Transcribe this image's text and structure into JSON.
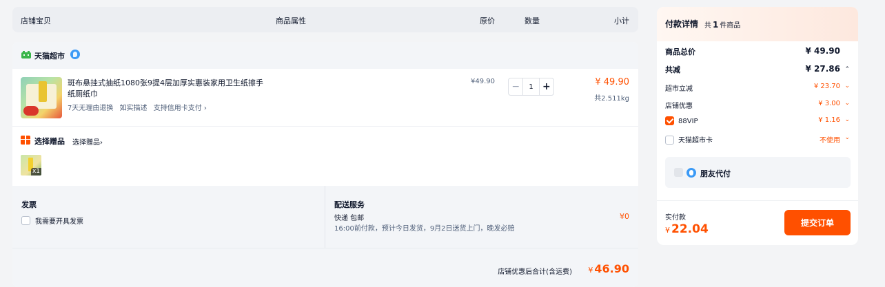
{
  "columns": {
    "item": "店铺宝贝",
    "attr": "商品属性",
    "price": "原价",
    "qty": "数量",
    "subtotal": "小计"
  },
  "shop": {
    "name": "天猫超市"
  },
  "product": {
    "title": "斑布悬挂式抽纸1080张9提4层加厚实惠装家用卫生纸擦手纸厕纸巾",
    "tags": [
      "7天无理由退换",
      "如实描述",
      "支持信用卡支付 ›"
    ],
    "price": "¥49.90",
    "quantity": "1",
    "subtotal": "¥ 49.90",
    "weight": "共2.511kg",
    "minus_symbol": "−",
    "plus_symbol": "+"
  },
  "gift": {
    "label": "选择赠品",
    "choose_link": "选择赠品›",
    "count": "x1"
  },
  "invoice": {
    "title": "发票",
    "option": "我需要开具发票"
  },
  "delivery": {
    "title": "配送服务",
    "method": "快递 包邮",
    "detail": "16:00前付款，预计今日发货，9月2日送货上门，晚发必赔",
    "fee": "¥0"
  },
  "shop_total": {
    "label": "店铺优惠后合计(含运费)",
    "currency": "¥",
    "value": "46.90"
  },
  "payment": {
    "title": "付款详情",
    "count_prefix": "共",
    "count": "1",
    "count_suffix": "件商品",
    "goods_total_label": "商品总价",
    "goods_total": "¥ 49.90",
    "discount_label": "共减",
    "discount_total": "¥ 27.86",
    "items": [
      {
        "label": "超市立减",
        "value": "¥ 23.70"
      },
      {
        "label": "店铺优惠",
        "value": "¥ 3.00"
      },
      {
        "label": "88VIP",
        "value": "¥ 1.16",
        "checked": true
      },
      {
        "label": "天猫超市卡",
        "value": "不使用",
        "checked": false
      }
    ],
    "friend_pay": "朋友代付",
    "actual_label": "实付款",
    "actual_currency": "¥",
    "actual_value": "22.04",
    "submit": "提交订单"
  },
  "colors": {
    "accent": "#ff5000",
    "text": "#11192d",
    "muted": "#50607a",
    "bg": "#f3f4f6"
  },
  "icons": {
    "shop_logo": "tmall-cat-icon",
    "badge": "shop-badge-icon",
    "gift": "gift-icon",
    "friend_pay": "friend-pay-icon",
    "expand": "chevron-up-icon",
    "collapse": "chevron-down-icon"
  }
}
